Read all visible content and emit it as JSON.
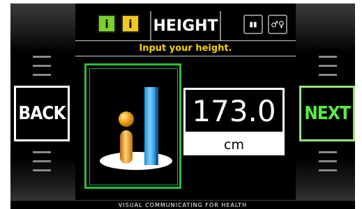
{
  "header": {
    "title": "HEIGHT",
    "icons": [
      "info-green-icon",
      "info-yellow-icon",
      "bar-chart-icon",
      "gender-icon"
    ],
    "icon_glyphs": {
      "info_green": "i",
      "info_yellow": "i",
      "chart": "▮▮",
      "gender": "♂♀"
    }
  },
  "instruction": "Input your height.",
  "nav": {
    "back_label": "BACK",
    "next_label": "NEXT"
  },
  "measurement": {
    "value": "173.0",
    "unit": "cm"
  },
  "footer": {
    "text": "VISUAL COMMUNICATING FOR HEALTH"
  },
  "colors": {
    "instruction": "#f5d400",
    "next": "#55ee44",
    "frame": "#2bbd3a",
    "orange": "#f2a51c",
    "blue": "#2aa6e6"
  }
}
